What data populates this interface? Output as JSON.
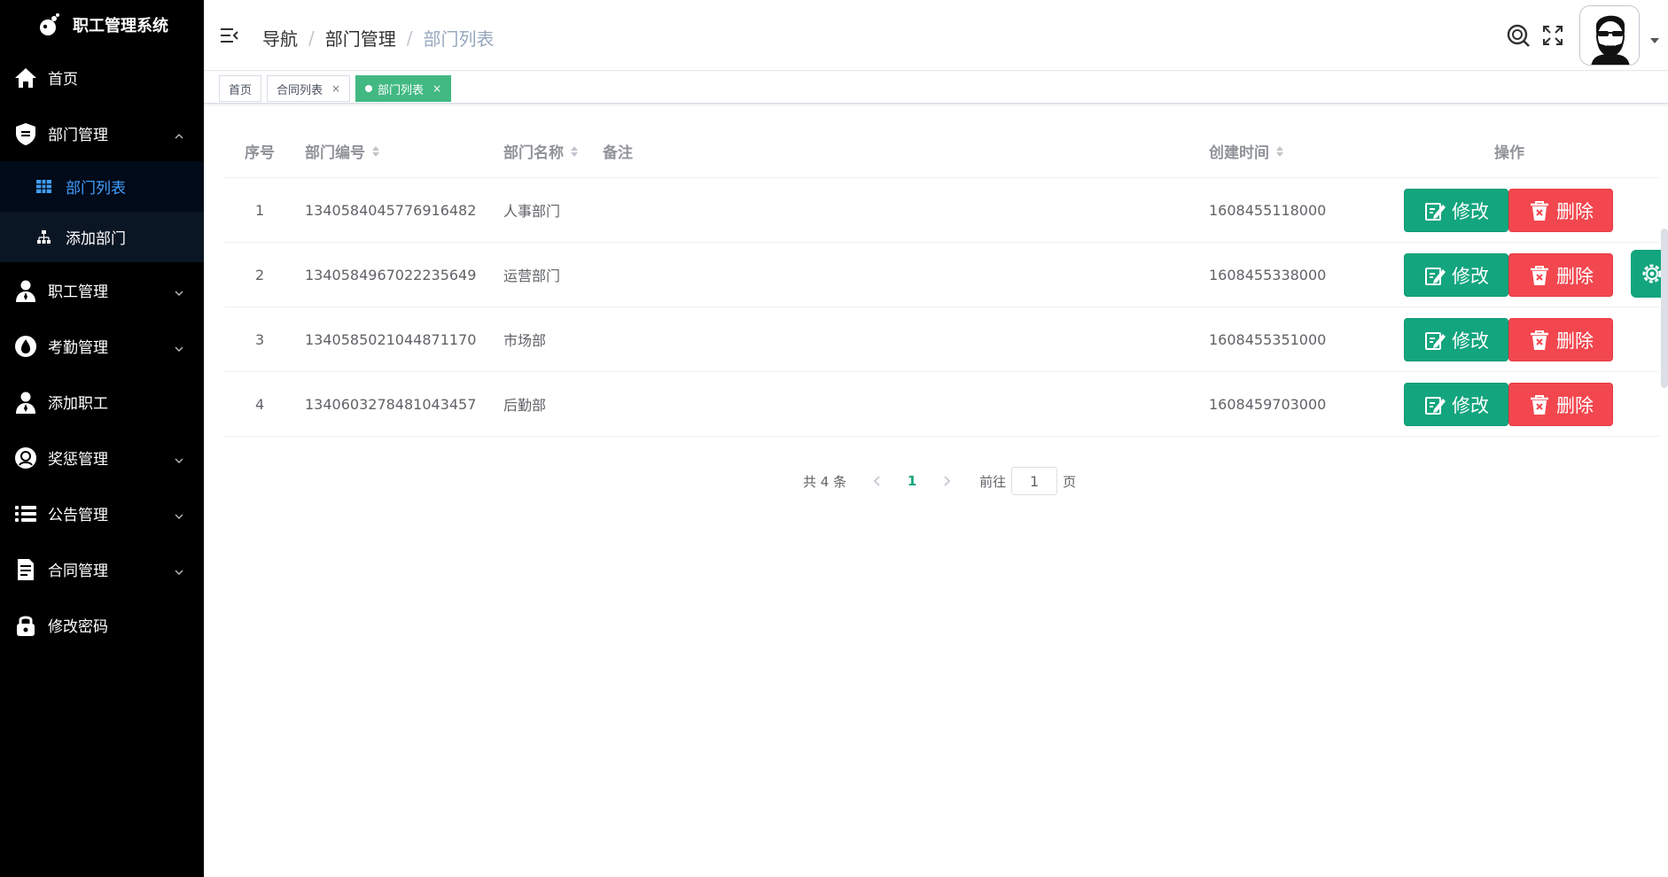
{
  "app": {
    "title": "职工管理系统"
  },
  "sidebar": {
    "menu": [
      {
        "key": "home",
        "label": "首页",
        "icon": "home-icon",
        "has_arrow": false
      },
      {
        "key": "dept",
        "label": "部门管理",
        "icon": "dept-shield-icon",
        "has_arrow": true,
        "expanded": true,
        "children": [
          {
            "key": "dept-list",
            "label": "部门列表",
            "icon": "grid-icon",
            "active": true
          },
          {
            "key": "dept-add",
            "label": "添加部门",
            "icon": "org-chart-icon",
            "active": false
          }
        ]
      },
      {
        "key": "staff",
        "label": "职工管理",
        "icon": "user-icon",
        "has_arrow": true
      },
      {
        "key": "attendance",
        "label": "考勤管理",
        "icon": "drop-icon",
        "has_arrow": true
      },
      {
        "key": "add-staff",
        "label": "添加职工",
        "icon": "user-add-icon",
        "has_arrow": false
      },
      {
        "key": "reward",
        "label": "奖惩管理",
        "icon": "badge-icon",
        "has_arrow": true
      },
      {
        "key": "notice",
        "label": "公告管理",
        "icon": "list-icon",
        "has_arrow": true
      },
      {
        "key": "contract",
        "label": "合同管理",
        "icon": "document-icon",
        "has_arrow": true
      },
      {
        "key": "password",
        "label": "修改密码",
        "icon": "lock-icon",
        "has_arrow": false
      }
    ]
  },
  "header": {
    "breadcrumb": [
      "导航",
      "部门管理",
      "部门列表"
    ],
    "separator": "/"
  },
  "tags": [
    {
      "label": "首页",
      "closable": false,
      "active": false
    },
    {
      "label": "合同列表",
      "closable": true,
      "active": false
    },
    {
      "label": "部门列表",
      "closable": true,
      "active": true
    }
  ],
  "tag_close_glyph": "×",
  "table": {
    "columns": {
      "index": "序号",
      "dept_no": "部门编号",
      "dept_name": "部门名称",
      "remark": "备注",
      "created": "创建时间",
      "actions": "操作"
    },
    "rows": [
      {
        "index": "1",
        "dept_no": "1340584045776916482",
        "dept_name": "人事部门",
        "remark": "",
        "created": "1608455118000"
      },
      {
        "index": "2",
        "dept_no": "1340584967022235649",
        "dept_name": "运营部门",
        "remark": "",
        "created": "1608455338000"
      },
      {
        "index": "3",
        "dept_no": "1340585021044871170",
        "dept_name": "市场部",
        "remark": "",
        "created": "1608455351000"
      },
      {
        "index": "4",
        "dept_no": "1340603278481043457",
        "dept_name": "后勤部",
        "remark": "",
        "created": "1608459703000"
      }
    ],
    "edit_label": "修改",
    "delete_label": "删除"
  },
  "pagination": {
    "total_text": "共 4 条",
    "current_page": "1",
    "goto_label": "前往",
    "goto_value": "1",
    "unit_label": "页"
  },
  "colors": {
    "sidebar_bg": "#000000",
    "active_menu": "#409eff",
    "primary_green": "#13a57e",
    "tag_active": "#42b983",
    "danger_red": "#f2474f"
  }
}
